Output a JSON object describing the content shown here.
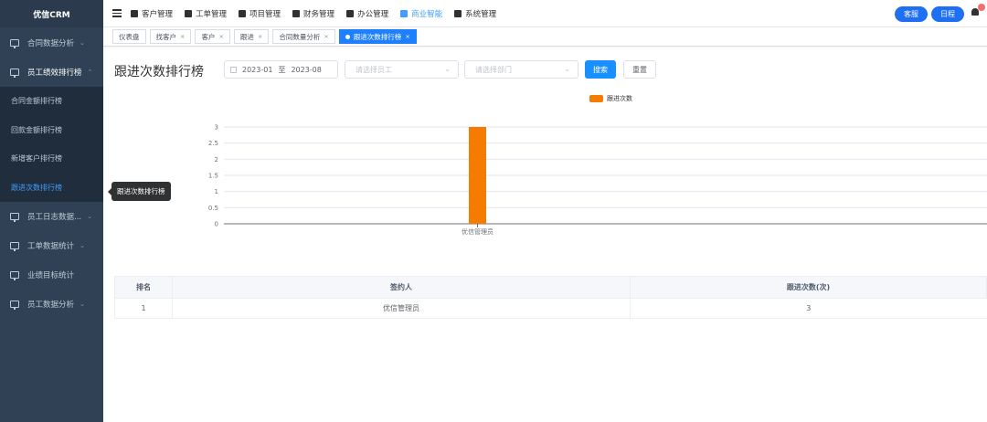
{
  "app": {
    "logo": "优信CRM"
  },
  "sidebar": {
    "items": [
      {
        "label": "合同数据分析",
        "chevron": "⌄"
      },
      {
        "label": "员工绩效排行榜",
        "chevron": "⌃"
      },
      {
        "label": "员工日志数据...",
        "chevron": "⌄"
      },
      {
        "label": "工单数据统计",
        "chevron": "⌄"
      },
      {
        "label": "业绩目标统计",
        "chevron": ""
      },
      {
        "label": "员工数据分析",
        "chevron": "⌄"
      }
    ],
    "subitems": [
      {
        "label": "合同金额排行榜"
      },
      {
        "label": "回款金额排行榜"
      },
      {
        "label": "新增客户排行榜"
      },
      {
        "label": "跟进次数排行榜"
      }
    ],
    "tooltip": "跟进次数排行榜"
  },
  "topnav": {
    "items": [
      {
        "label": "客户管理"
      },
      {
        "label": "工单管理"
      },
      {
        "label": "项目管理"
      },
      {
        "label": "财务管理"
      },
      {
        "label": "办公管理"
      },
      {
        "label": "商业智能"
      },
      {
        "label": "系统管理"
      }
    ],
    "service_label": "客服",
    "schedule_label": "日程"
  },
  "tags": [
    {
      "label": "仪表盘",
      "close": ""
    },
    {
      "label": "找客户",
      "close": "×"
    },
    {
      "label": "客户",
      "close": "×"
    },
    {
      "label": "跟进",
      "close": "×"
    },
    {
      "label": "合同数量分析",
      "close": "×"
    },
    {
      "label": "跟进次数排行榜",
      "close": "×"
    }
  ],
  "filters": {
    "page_title": "跟进次数排行榜",
    "date_start": "2023-01",
    "date_sep": "至",
    "date_end": "2023-08",
    "employee_placeholder": "请选择员工",
    "department_placeholder": "请选择部门",
    "search_label": "搜索",
    "reset_label": "重置"
  },
  "chart_data": {
    "type": "bar",
    "categories": [
      "优信管理员"
    ],
    "series": [
      {
        "name": "跟进次数",
        "values": [
          3
        ],
        "color": "#f57c00"
      }
    ],
    "ylim": [
      0,
      3
    ],
    "yticks": [
      "0",
      "0.5",
      "1",
      "1.5",
      "2",
      "2.5",
      "3"
    ],
    "grid": true,
    "legend": "top-center"
  },
  "table": {
    "headers": [
      "排名",
      "签约人",
      "跟进次数(次)"
    ],
    "rows": [
      [
        "1",
        "优信管理员",
        "3"
      ]
    ]
  },
  "colors": {
    "sidebar_bg": "#304156",
    "accent": "#409eff",
    "bar": "#f57c00",
    "button": "#1e6ff1"
  }
}
